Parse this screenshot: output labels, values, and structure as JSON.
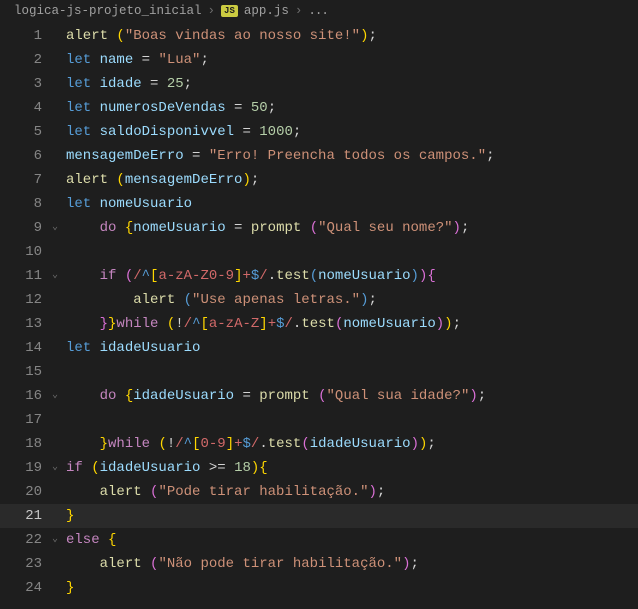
{
  "breadcrumb": {
    "folder": "logica-js-projeto_inicial",
    "file": "app.js",
    "badge": "JS",
    "ellipsis": "..."
  },
  "gutter": {
    "1": "1",
    "2": "2",
    "3": "3",
    "4": "4",
    "5": "5",
    "6": "6",
    "7": "7",
    "8": "8",
    "9": "9",
    "10": "10",
    "11": "11",
    "12": "12",
    "13": "13",
    "14": "14",
    "15": "15",
    "16": "16",
    "17": "17",
    "18": "18",
    "19": "19",
    "20": "20",
    "21": "21",
    "22": "22",
    "23": "23",
    "24": "24"
  },
  "fold": {
    "down": "⌄"
  },
  "t": {
    "alert": "alert",
    "let": "let",
    "name": "name",
    "Lua": "\"Lua\"",
    "idade": "idade",
    "n25": "25",
    "numerosDeVendas": "numerosDeVendas",
    "n50": "50",
    "saldoDisponivvel": "saldoDisponivvel",
    "n1000": "1000",
    "mensagemDeErro": "mensagemDeErro",
    "erroStr": "\"Erro! Preencha todos os campos.\"",
    "boas": "\"Boas vindas ao nosso site!\"",
    "nomeUsuario": "nomeUsuario",
    "do": "do",
    "prompt": "prompt",
    "qualNome": "\"Qual seu nome?\"",
    "if": "if",
    "test": "test",
    "useLetras": "\"Use apenas letras.\"",
    "while": "while",
    "idadeUsuario": "idadeUsuario",
    "qualIdade": "\"Qual sua idade?\"",
    "ge18": ">= ",
    "n18": "18",
    "podeTirar": "\"Pode tirar habilitação.\"",
    "else": "else",
    "naoPode": "\"Não pode tirar habilitação.\"",
    "eq": " = ",
    "semi": ";",
    "sp": " ",
    "op": "(",
    "cp": ")",
    "ob": "{",
    "cb": "}",
    "comma": ", ",
    "dot": ".",
    "bang": "!",
    "slash": "/",
    "plus": "+",
    "dollar": "$",
    "caret": "^",
    "rgx_alnum_open": "[",
    "rgx_alnum_body": "a-zA-Z0-9",
    "rgx_close": "]",
    "rgx_alpha_body": "a-zA-Z",
    "rgx_digit_body": "0-9"
  }
}
